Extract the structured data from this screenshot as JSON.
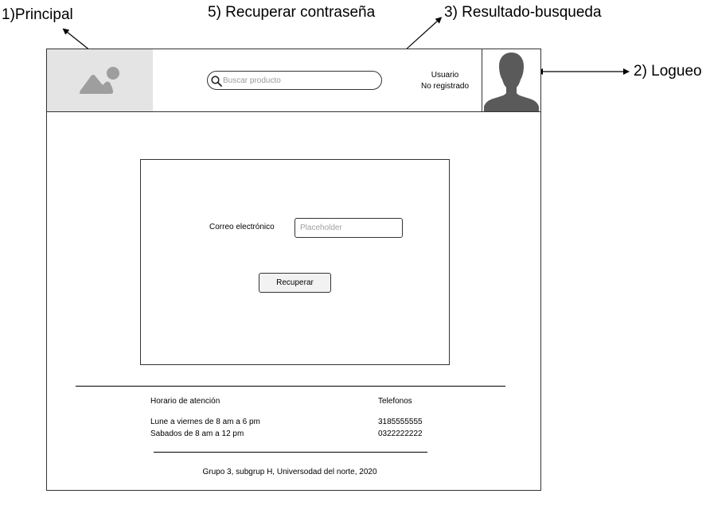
{
  "annotations": {
    "principal": "1)Principal",
    "recuperar": "5) Recuperar contraseña",
    "resultado": "3) Resultado-busqueda",
    "logueo": "2) Logueo"
  },
  "header": {
    "logo_icon": "image-placeholder-icon",
    "search_icon": "search-icon",
    "search_placeholder": "Buscar producto",
    "user_line1": "Usuario",
    "user_line2": "No registrado",
    "avatar_icon": "user-silhouette-icon"
  },
  "recovery_form": {
    "email_label": "Correo electrónico",
    "email_placeholder": "Placeholder",
    "email_value": "",
    "recover_button": "Recuperar"
  },
  "footer": {
    "hours_title": "Horario de atención",
    "hours_weekdays": "Lune a viernes de 8 am a 6 pm",
    "hours_saturday": "Sabados de 8 am a 12 pm",
    "phones_title": "Telefonos",
    "phone_1": "3185555555",
    "phone_2": "0322222222",
    "copyright": "Grupo 3, subgrup H, Universodad del norte, 2020"
  },
  "colors": {
    "logo_background": "#e4e4e4",
    "placeholder_shape": "#9e9e9e",
    "avatar_silhouette": "#5a5a5a",
    "border": "#333333"
  }
}
